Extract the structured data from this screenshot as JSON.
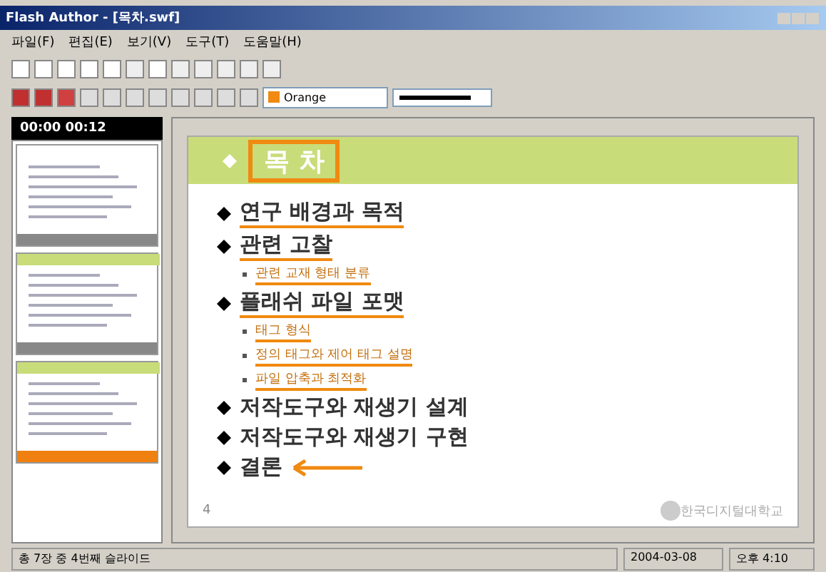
{
  "window": {
    "title": "Flash Author - [목차.swf]"
  },
  "menu": [
    "파일(F)",
    "편집(E)",
    "보기(V)",
    "도구(T)",
    "도움말(H)"
  ],
  "toolbar": {
    "color_select": "Orange"
  },
  "timer": "00:00 00:12",
  "thumbnails": [
    {
      "selected": false
    },
    {
      "selected": false
    },
    {
      "selected": true
    }
  ],
  "slide": {
    "title": "목 차",
    "items": [
      {
        "text": "연구 배경과 목적",
        "underlined": true
      },
      {
        "text": "관련 고찰",
        "underlined": true,
        "children": [
          {
            "text": "관련 교재 형태 분류",
            "underlined": true
          }
        ]
      },
      {
        "text": "플래쉬 파일 포맷",
        "underlined": true,
        "children": [
          {
            "text": "태그 형식",
            "underlined": true
          },
          {
            "text": "정의 태그와 제어 태그 설명",
            "underlined": true
          },
          {
            "text": "파일 압축과 최적화",
            "underlined": true
          }
        ]
      },
      {
        "text": "저작도구와 재생기 설계",
        "underlined": false
      },
      {
        "text": "저작도구와 재생기 구현",
        "underlined": false
      },
      {
        "text": "결론",
        "underlined": false,
        "arrow": true
      }
    ],
    "page": "4",
    "logo": "한국디지털대학교"
  },
  "status": {
    "left": "총 7장 중 4번째 슬라이드",
    "date": "2004-03-08",
    "time": "오후 4:10"
  }
}
